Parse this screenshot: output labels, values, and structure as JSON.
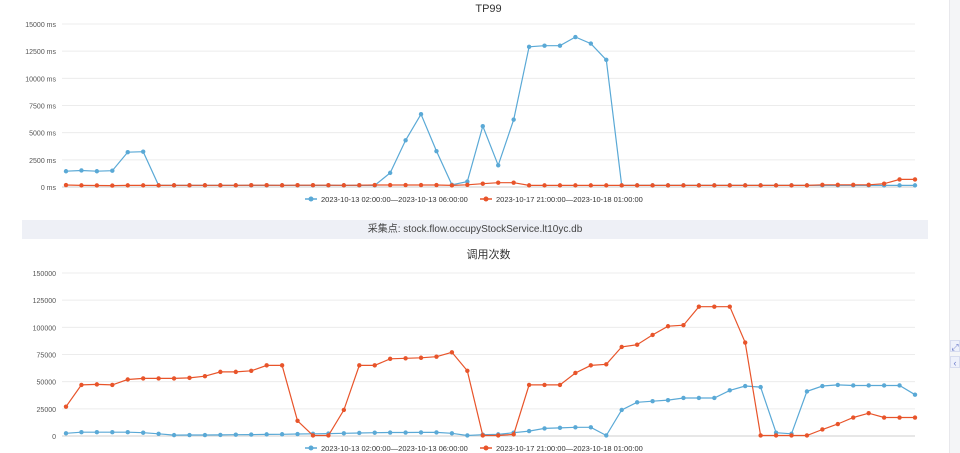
{
  "separator": {
    "text": "采集点:  stock.flow.occupyStockService.lt10yc.db"
  },
  "side_controls": {
    "icon_top": "expand-icon",
    "icon_bottom": "chevron-left-icon"
  },
  "colors": {
    "series_a": "#5aa9d6",
    "series_b": "#e8542a",
    "grid": "#ececec",
    "axis_text": "#555555"
  },
  "chart_data": [
    {
      "type": "line",
      "title": "TP99",
      "ylim": [
        0,
        15000
      ],
      "yticks": [
        "0 ms",
        "2500 ms",
        "5000 ms",
        "7500 ms",
        "10000 ms",
        "12500 ms",
        "15000 ms"
      ],
      "grid": true,
      "legend_position": "bottom-center",
      "series": [
        {
          "name": "2023-10-13 02:00:00—2023-10-13 06:00:00",
          "values": [
            1450,
            1520,
            1450,
            1500,
            3200,
            3250,
            150,
            150,
            150,
            150,
            150,
            150,
            150,
            150,
            150,
            150,
            150,
            150,
            150,
            150,
            150,
            1300,
            4300,
            6700,
            3300,
            200,
            500,
            5600,
            2000,
            6200,
            12900,
            13000,
            13000,
            13800,
            13200,
            11700,
            150,
            150,
            150,
            150,
            150,
            150,
            150,
            150,
            150,
            150,
            150,
            150,
            150,
            150,
            150,
            150,
            150,
            150,
            150,
            150
          ]
        },
        {
          "name": "2023-10-17 21:00:00—2023-10-18 01:00:00",
          "values": [
            180,
            150,
            140,
            130,
            150,
            150,
            150,
            160,
            160,
            160,
            160,
            160,
            170,
            170,
            160,
            170,
            170,
            170,
            160,
            170,
            180,
            180,
            180,
            180,
            180,
            150,
            200,
            300,
            400,
            400,
            150,
            150,
            150,
            150,
            150,
            150,
            150,
            150,
            150,
            150,
            150,
            150,
            150,
            150,
            150,
            150,
            150,
            150,
            150,
            200,
            200,
            200,
            200,
            300,
            700,
            700
          ]
        }
      ]
    },
    {
      "type": "line",
      "title": "调用次数",
      "ylim": [
        0,
        150000
      ],
      "yticks": [
        "0",
        "25000",
        "50000",
        "75000",
        "100000",
        "125000",
        "150000"
      ],
      "grid": true,
      "legend_position": "bottom-center",
      "series": [
        {
          "name": "2023-10-13 02:00:00—2023-10-13 06:00:00",
          "values": [
            2500,
            3500,
            3500,
            3500,
            3500,
            3000,
            2000,
            800,
            900,
            900,
            1000,
            1200,
            1300,
            1500,
            1600,
            1800,
            2000,
            2200,
            2500,
            2800,
            3000,
            3200,
            3200,
            3300,
            3300,
            2500,
            500,
            1200,
            1500,
            3000,
            4500,
            7000,
            7500,
            8000,
            8000,
            500,
            24000,
            31000,
            32000,
            33000,
            35000,
            35000,
            35000,
            42000,
            46000,
            45000,
            3000,
            2000,
            41000,
            46000,
            47000,
            46500,
            46500,
            46500,
            46500,
            38000
          ]
        },
        {
          "name": "2023-10-17 21:00:00—2023-10-18 01:00:00",
          "values": [
            27000,
            47000,
            47500,
            47000,
            52000,
            53000,
            53000,
            53000,
            53500,
            55000,
            59000,
            59000,
            60000,
            65000,
            65000,
            14000,
            500,
            500,
            24000,
            65000,
            65000,
            71000,
            71500,
            72000,
            73000,
            77000,
            60000,
            500,
            500,
            1500,
            47000,
            47000,
            47000,
            58000,
            65000,
            66000,
            82000,
            84000,
            93000,
            101000,
            102000,
            119000,
            119000,
            119000,
            86000,
            500,
            500,
            500,
            500,
            6000,
            11000,
            17000,
            21000,
            17000,
            17000,
            17000
          ]
        }
      ]
    }
  ]
}
